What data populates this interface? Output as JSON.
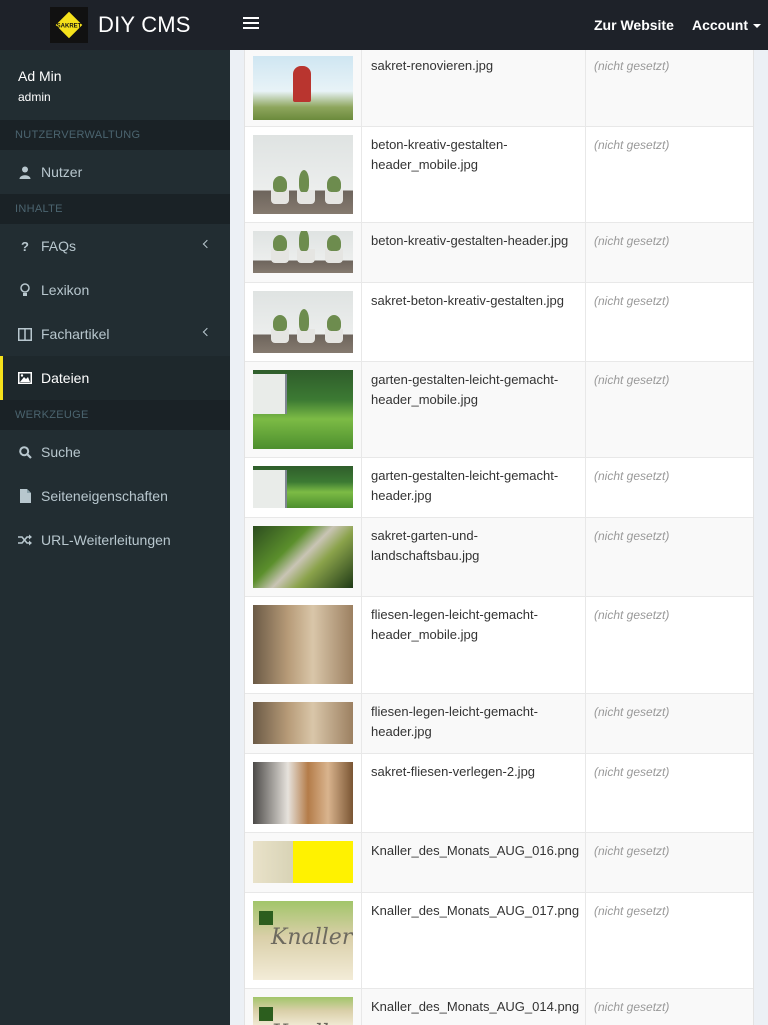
{
  "app": {
    "brand": "DIY CMS",
    "logo_text": "SAKRET",
    "accent_color": "#f5e11b",
    "topbar_color": "#1e2229",
    "sidebar_color": "#222d32"
  },
  "header": {
    "menu_icon": "hamburger-icon",
    "links": {
      "website": "Zur Website",
      "account": "Account"
    }
  },
  "user": {
    "name": "Ad Min",
    "login": "admin"
  },
  "sidebar": {
    "sections": {
      "users": "NUTZERVERWALTUNG",
      "content": "INHALTE",
      "tools": "WERKZEUGE"
    },
    "items": {
      "nutzer": {
        "label": "Nutzer",
        "icon": "user-icon"
      },
      "faqs": {
        "label": "FAQs",
        "icon": "question-icon"
      },
      "lexikon": {
        "label": "Lexikon",
        "icon": "lightbulb-icon"
      },
      "fachartikel": {
        "label": "Fachartikel",
        "icon": "columns-icon"
      },
      "dateien": {
        "label": "Dateien",
        "icon": "image-icon",
        "active": true
      },
      "suche": {
        "label": "Suche",
        "icon": "search-icon"
      },
      "seiteneigenschaften": {
        "label": "Seiteneigenschaften",
        "icon": "file-icon"
      },
      "url": {
        "label": "URL-Weiterleitungen",
        "icon": "shuffle-icon"
      }
    }
  },
  "files": {
    "rows": [
      {
        "name": "sakret-renovieren.jpg",
        "alt": "(nicht gesetzt)",
        "thumb": "reno"
      },
      {
        "name": "beton-kreativ-gestalten-header_mobile.jpg",
        "alt": "(nicht gesetzt)",
        "thumb": "plants"
      },
      {
        "name": "beton-kreativ-gestalten-header.jpg",
        "alt": "(nicht gesetzt)",
        "thumb": "plants"
      },
      {
        "name": "sakret-beton-kreativ-gestalten.jpg",
        "alt": "(nicht gesetzt)",
        "thumb": "plants"
      },
      {
        "name": "garten-gestalten-leicht-gemacht-header_mobile.jpg",
        "alt": "(nicht gesetzt)",
        "thumb": "garden"
      },
      {
        "name": "garten-gestalten-leicht-gemacht-header.jpg",
        "alt": "(nicht gesetzt)",
        "thumb": "garden"
      },
      {
        "name": "sakret-garten-und-landschaftsbau.jpg",
        "alt": "(nicht gesetzt)",
        "thumb": "path"
      },
      {
        "name": "fliesen-legen-leicht-gemacht-header_mobile.jpg",
        "alt": "(nicht gesetzt)",
        "thumb": "bath"
      },
      {
        "name": "fliesen-legen-leicht-gemacht-header.jpg",
        "alt": "(nicht gesetzt)",
        "thumb": "bath"
      },
      {
        "name": "sakret-fliesen-verlegen-2.jpg",
        "alt": "(nicht gesetzt)",
        "thumb": "tiles"
      },
      {
        "name": "Knaller_des_Monats_AUG_016.png",
        "alt": "(nicht gesetzt)",
        "thumb": "kn16"
      },
      {
        "name": "Knaller_des_Monats_AUG_017.png",
        "alt": "(nicht gesetzt)",
        "thumb": "kn17",
        "thumb_text": "Knaller"
      },
      {
        "name": "Knaller_des_Monats_AUG_014.png",
        "alt": "(nicht gesetzt)",
        "thumb": "kn17",
        "thumb_text": "Knaller"
      }
    ]
  }
}
